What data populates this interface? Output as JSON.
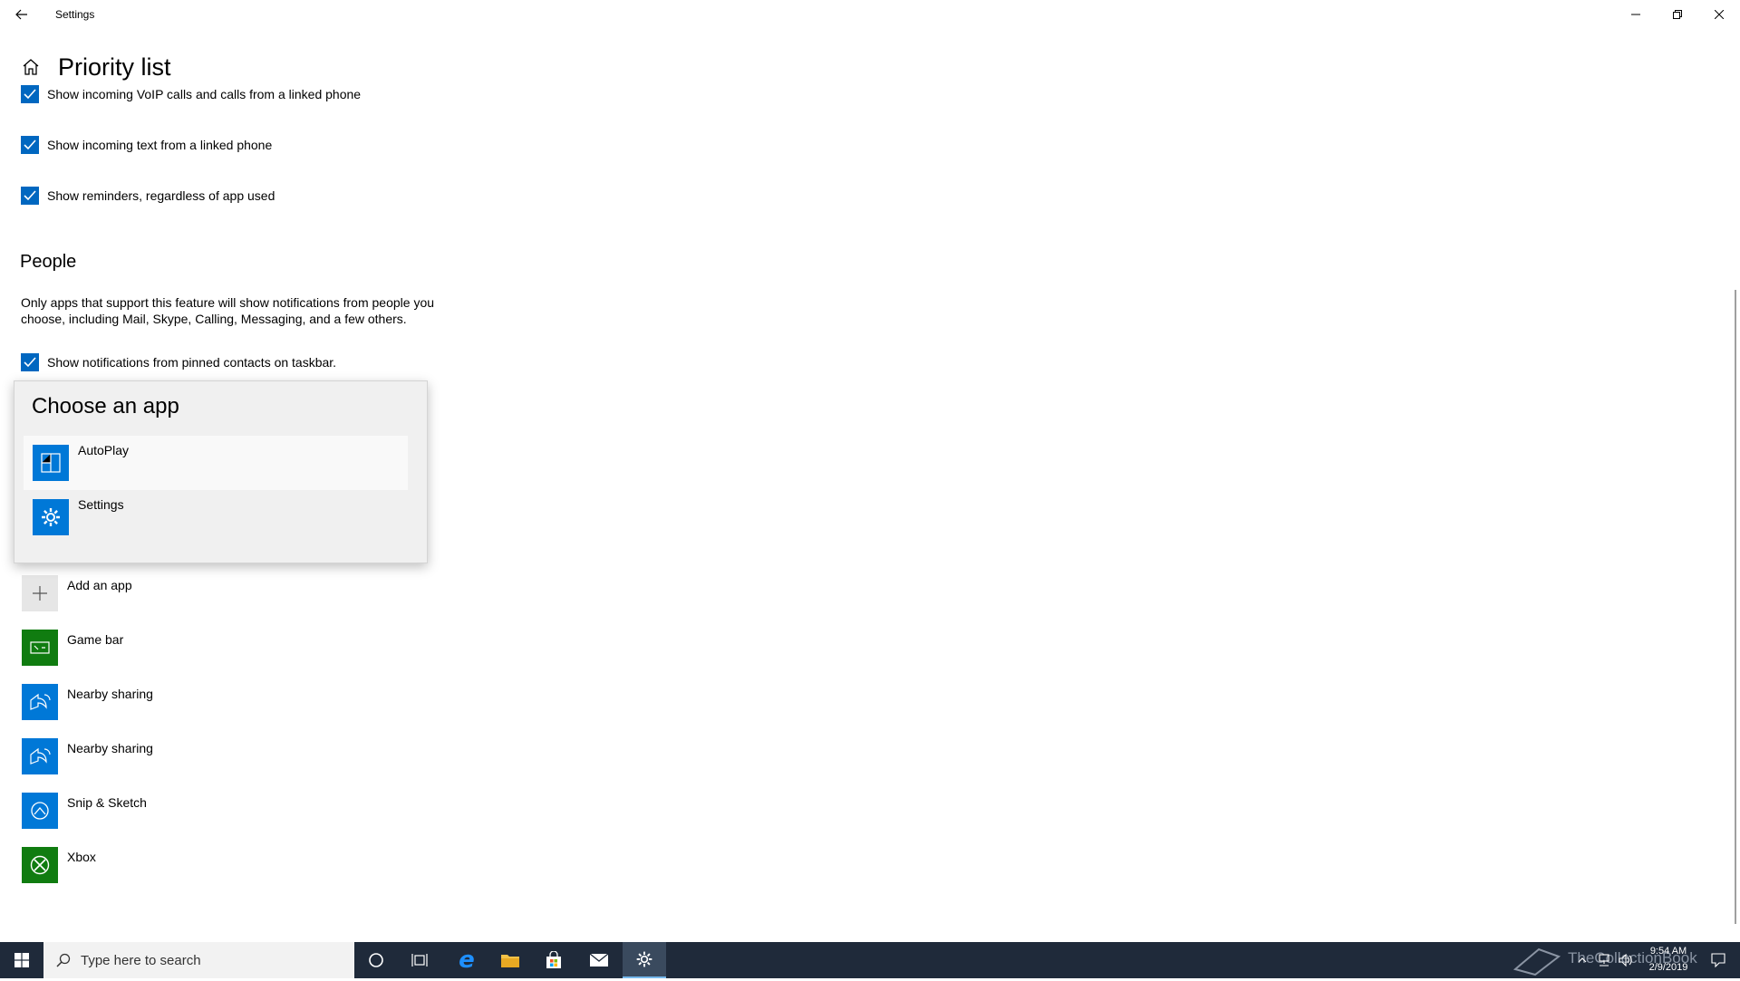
{
  "window": {
    "title": "Settings"
  },
  "page": {
    "title": "Priority list"
  },
  "checkboxes": [
    {
      "label": "Show incoming VoIP calls and calls from a linked phone",
      "checked": true
    },
    {
      "label": "Show incoming text from a linked phone",
      "checked": true
    },
    {
      "label": "Show reminders, regardless of app used",
      "checked": true
    }
  ],
  "people": {
    "title": "People",
    "description": "Only apps that support this feature will show notifications from people you choose, including Mail, Skype, Calling, Messaging, and a few others.",
    "pinned_label": "Show notifications from pinned contacts on taskbar."
  },
  "popup": {
    "title": "Choose an app",
    "items": [
      {
        "name": "AutoPlay",
        "icon": "autoplay-icon"
      },
      {
        "name": "Settings",
        "icon": "gear-icon"
      }
    ]
  },
  "apps": {
    "add_label": "Add an app",
    "items": [
      {
        "name": "Game bar",
        "icon": "gamebar-icon",
        "color": "#107c10"
      },
      {
        "name": "Nearby sharing",
        "icon": "share-icon",
        "color": "#0078d7"
      },
      {
        "name": "Nearby sharing",
        "icon": "share-icon",
        "color": "#0078d7"
      },
      {
        "name": "Snip & Sketch",
        "icon": "snip-icon",
        "color": "#0078d7"
      },
      {
        "name": "Xbox",
        "icon": "xbox-icon",
        "color": "#107c10"
      }
    ]
  },
  "taskbar": {
    "search_placeholder": "Type here to search",
    "time": "9:54 AM",
    "date": "2/9/2019",
    "watermark": "TheCollectionBook"
  },
  "colors": {
    "accent": "#0067c0",
    "tile_blue": "#0078d7",
    "tile_green": "#107c10"
  }
}
